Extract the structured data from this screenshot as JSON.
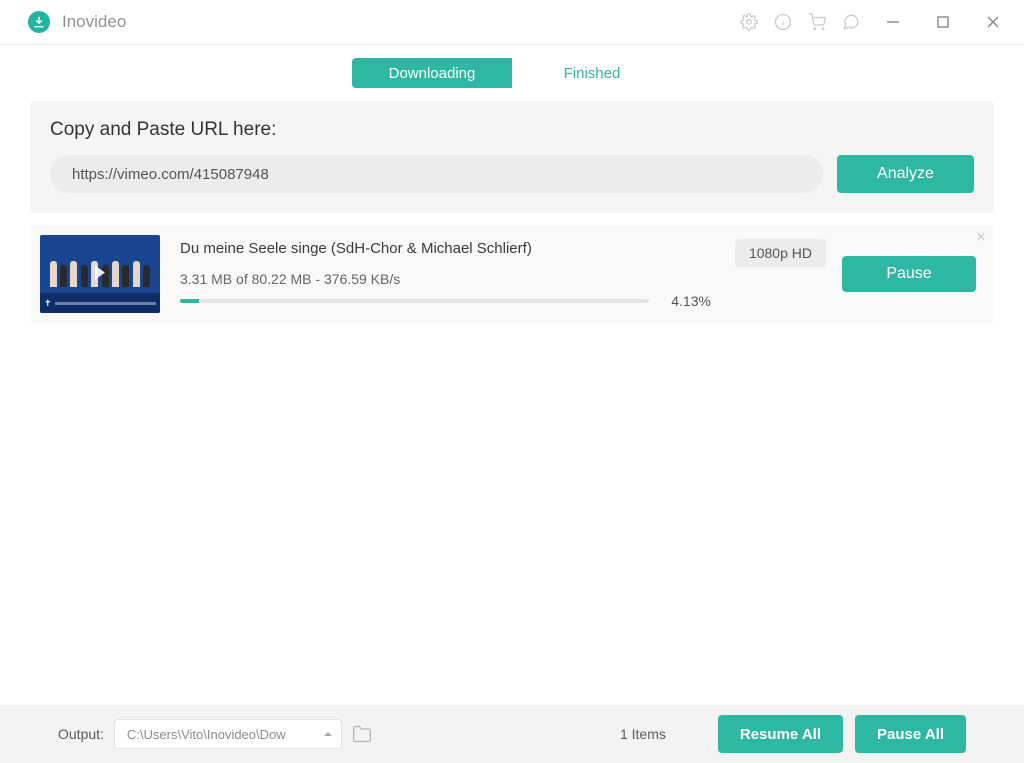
{
  "app": {
    "name": "Inovideo"
  },
  "tabs": {
    "downloading": "Downloading",
    "finished": "Finished",
    "active": "downloading"
  },
  "url_panel": {
    "label": "Copy and Paste URL here:",
    "value": "https://vimeo.com/415087948",
    "analyze": "Analyze"
  },
  "downloads": [
    {
      "title": "Du meine Seele singe (SdH-Chor & Michael Schlierf)",
      "downloaded_mb": "3.31 MB",
      "total_mb": "80.22 MB",
      "speed": "376.59 KB/s",
      "stats_line": "3.31 MB of 80.22 MB - 376.59 KB/s",
      "percent": "4.13%",
      "percent_num": 4.13,
      "quality": "1080p HD",
      "pause_label": "Pause"
    }
  ],
  "footer": {
    "output_label": "Output:",
    "output_path": "C:\\Users\\Vito\\Inovideo\\Dow",
    "items_count": "1 Items",
    "resume_all": "Resume All",
    "pause_all": "Pause All"
  },
  "colors": {
    "accent": "#2eb7a3"
  }
}
